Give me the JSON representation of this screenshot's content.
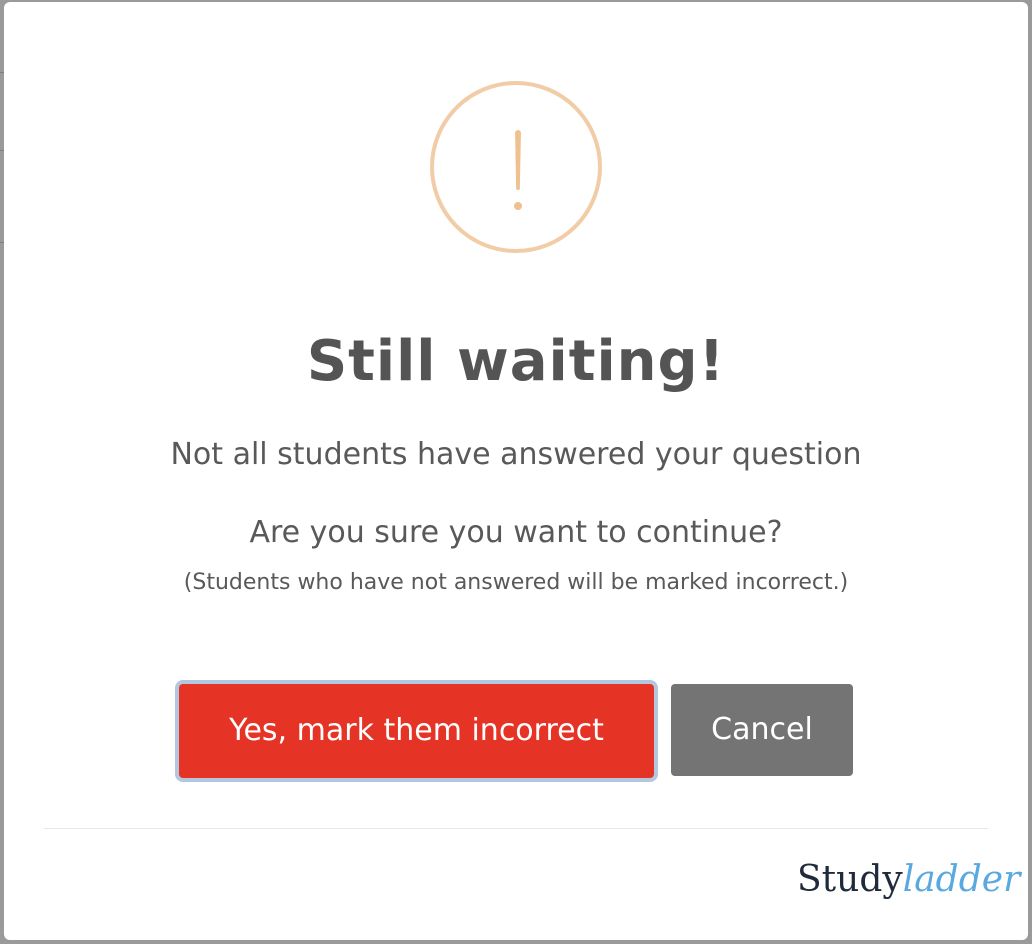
{
  "dialog": {
    "icon": "exclamation-icon",
    "title": "Still waiting!",
    "message": "Not all students have answered your question",
    "question": "Are you sure you want to continue?",
    "note": "(Students who have not answered will be marked incorrect.)",
    "confirm_label": "Yes, mark them incorrect",
    "cancel_label": "Cancel"
  },
  "branding": {
    "logo_part1": "Study",
    "logo_part2": "ladder"
  },
  "colors": {
    "confirm": "#e53426",
    "cancel": "#747474",
    "warning_icon": "#f1cca6",
    "logo_dark": "#1f2b3a",
    "logo_accent": "#59a8df"
  }
}
